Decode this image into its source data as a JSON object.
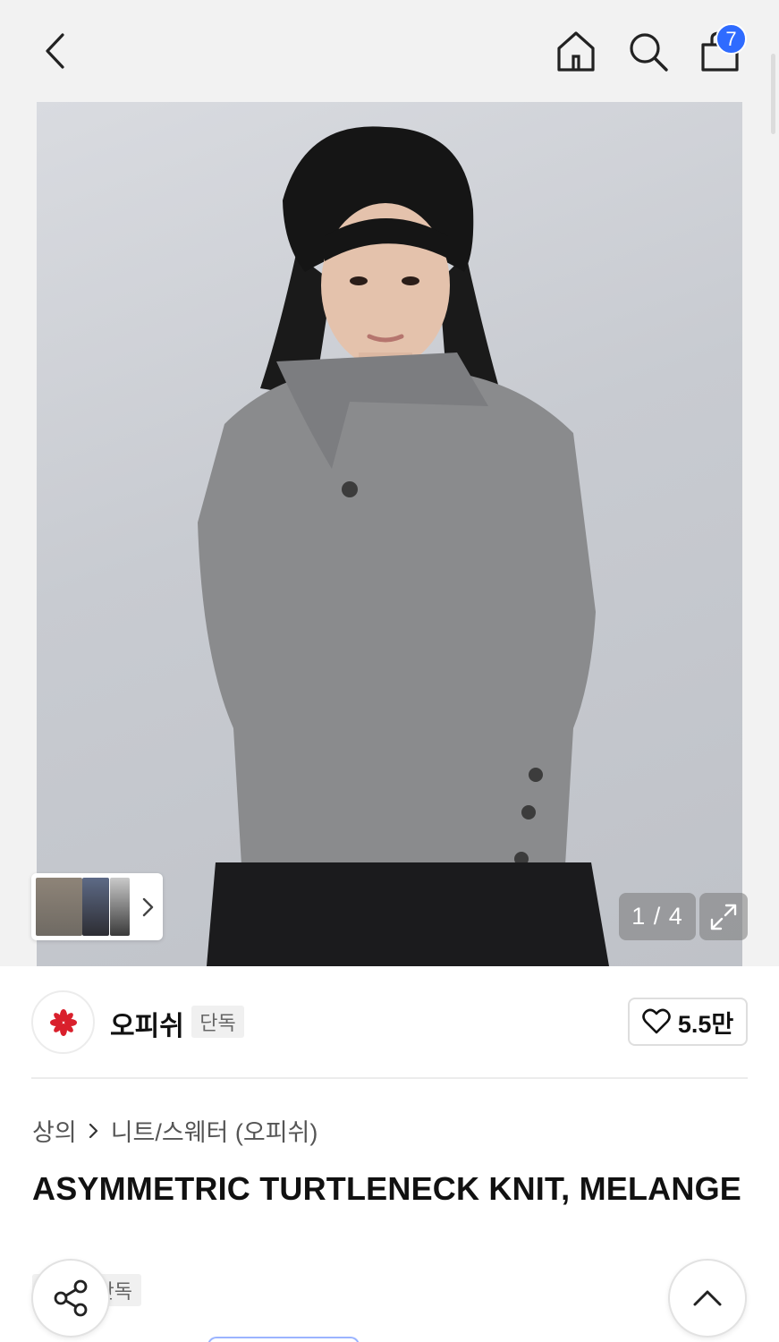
{
  "nav": {
    "back_icon": "chevron-left-icon",
    "home_icon": "home-icon",
    "search_icon": "search-icon",
    "cart_icon": "shopping-bag-icon",
    "cart_count": "7"
  },
  "gallery": {
    "counter": "1 / 4",
    "expand_icon": "expand-icon",
    "thumbnails_next_icon": "chevron-right-icon"
  },
  "brand": {
    "logo_icon": "asterisk-flower-icon",
    "name": "오피쉬",
    "tag": "단독",
    "like_count": "5.5만",
    "like_icon": "heart-icon"
  },
  "breadcrumb": {
    "category": "상의",
    "subcategory": "니트/스웨터 (오피쉬)"
  },
  "product": {
    "title": "ASYMMETRIC TURTLENECK KNIT, MELANGE",
    "tag": "단독"
  },
  "floating": {
    "share_icon": "share-icon",
    "scroll_top_icon": "chevron-up-icon"
  },
  "colors": {
    "badge": "#2f6bff",
    "logo_red": "#d9202c"
  }
}
